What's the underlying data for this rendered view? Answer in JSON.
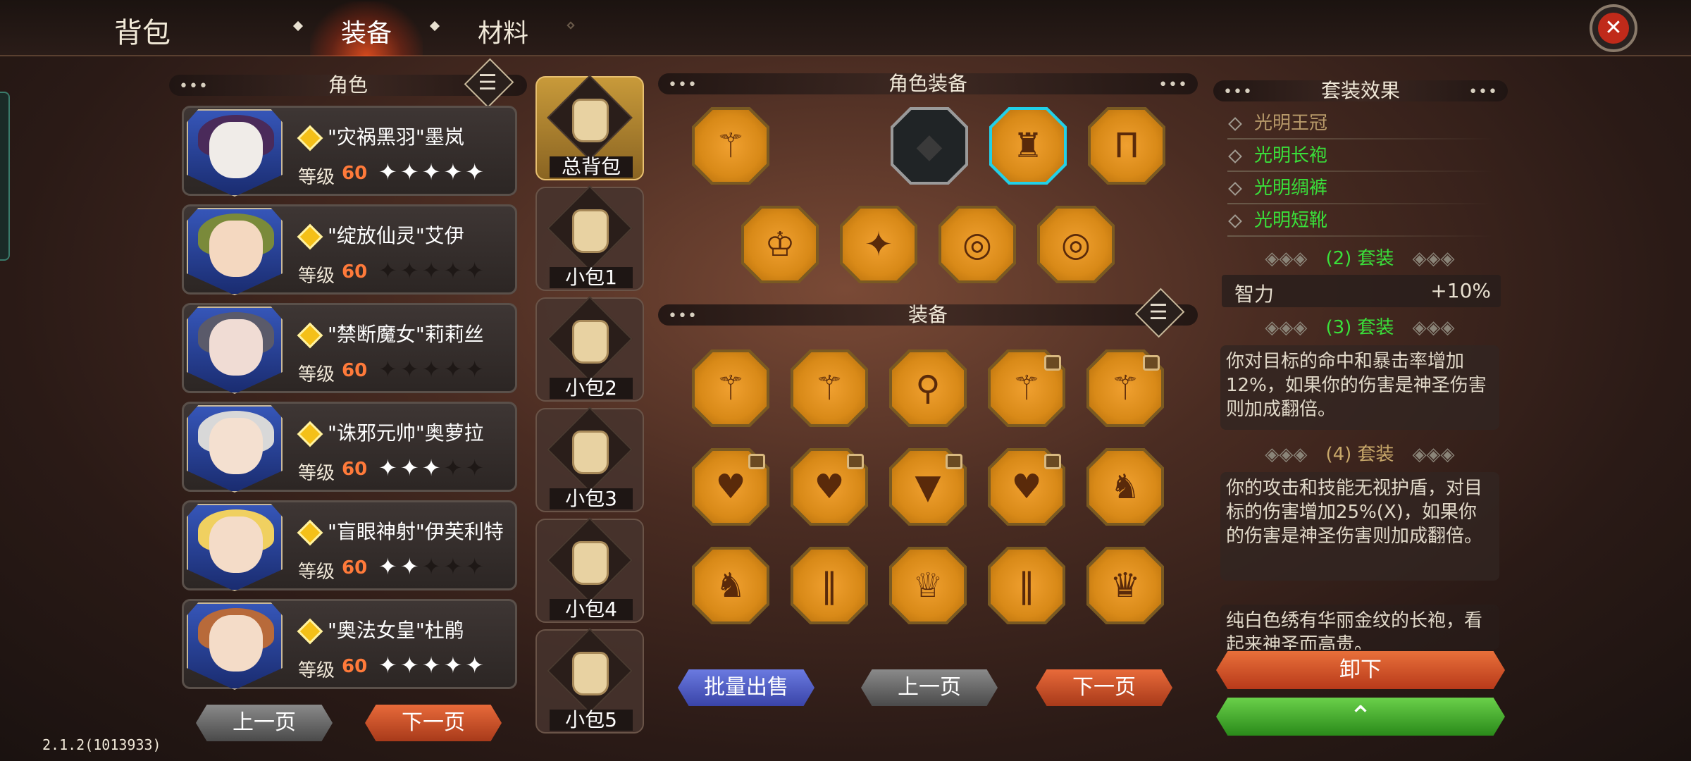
{
  "header": {
    "title": "背包",
    "tabs": [
      {
        "label": "装备",
        "active": true
      },
      {
        "label": "材料",
        "active": false
      }
    ]
  },
  "characters": {
    "title": "角色",
    "list": [
      {
        "name": "\"灾祸黑羽\"墨岚",
        "level_label": "等级",
        "level": "60",
        "stars": 5
      },
      {
        "name": "\"绽放仙灵\"艾伊",
        "level_label": "等级",
        "level": "60",
        "stars": 0
      },
      {
        "name": "\"禁断魔女\"莉莉丝",
        "level_label": "等级",
        "level": "60",
        "stars": 0
      },
      {
        "name": "\"诛邪元帅\"奥萝拉",
        "level_label": "等级",
        "level": "60",
        "stars": 3
      },
      {
        "name": "\"盲眼神射\"伊芙利特",
        "level_label": "等级",
        "level": "60",
        "stars": 2
      },
      {
        "name": "\"奥法女皇\"杜鹃",
        "level_label": "等级",
        "level": "60",
        "stars": 5
      }
    ],
    "prev": "上一页",
    "next": "下一页"
  },
  "bags": [
    "总背包",
    "小包1",
    "小包2",
    "小包3",
    "小包4",
    "小包5"
  ],
  "equipped": {
    "title": "角色装备"
  },
  "inventory": {
    "title": "装备",
    "sell": "批量出售",
    "prev": "上一页",
    "next": "下一页"
  },
  "set": {
    "title": "套装效果",
    "top_partial": "",
    "items": [
      {
        "name": "光明王冠",
        "color": "#b89a6a"
      },
      {
        "name": "光明长袍",
        "color": "#3ae03a"
      },
      {
        "name": "光明绸裤",
        "color": "#3ae03a"
      },
      {
        "name": "光明短靴",
        "color": "#3ae03a"
      }
    ],
    "tier2": "(2) 套装",
    "stat_name": "智力",
    "stat_value": "+10%",
    "tier3": "(3) 套装",
    "desc3": "你对目标的命中和暴击率增加12%，如果你的伤害是神圣伤害则加成翻倍。",
    "tier4": "(4) 套装",
    "desc4": "你的攻击和技能无视护盾，对目标的伤害增加25%(X)，如果你的伤害是神圣伤害则加成翻倍。",
    "flavor": "纯白色绣有华丽金纹的长袍，看起来神圣而高贵。",
    "unequip": "卸下"
  },
  "version": "2.1.2(1013933)"
}
